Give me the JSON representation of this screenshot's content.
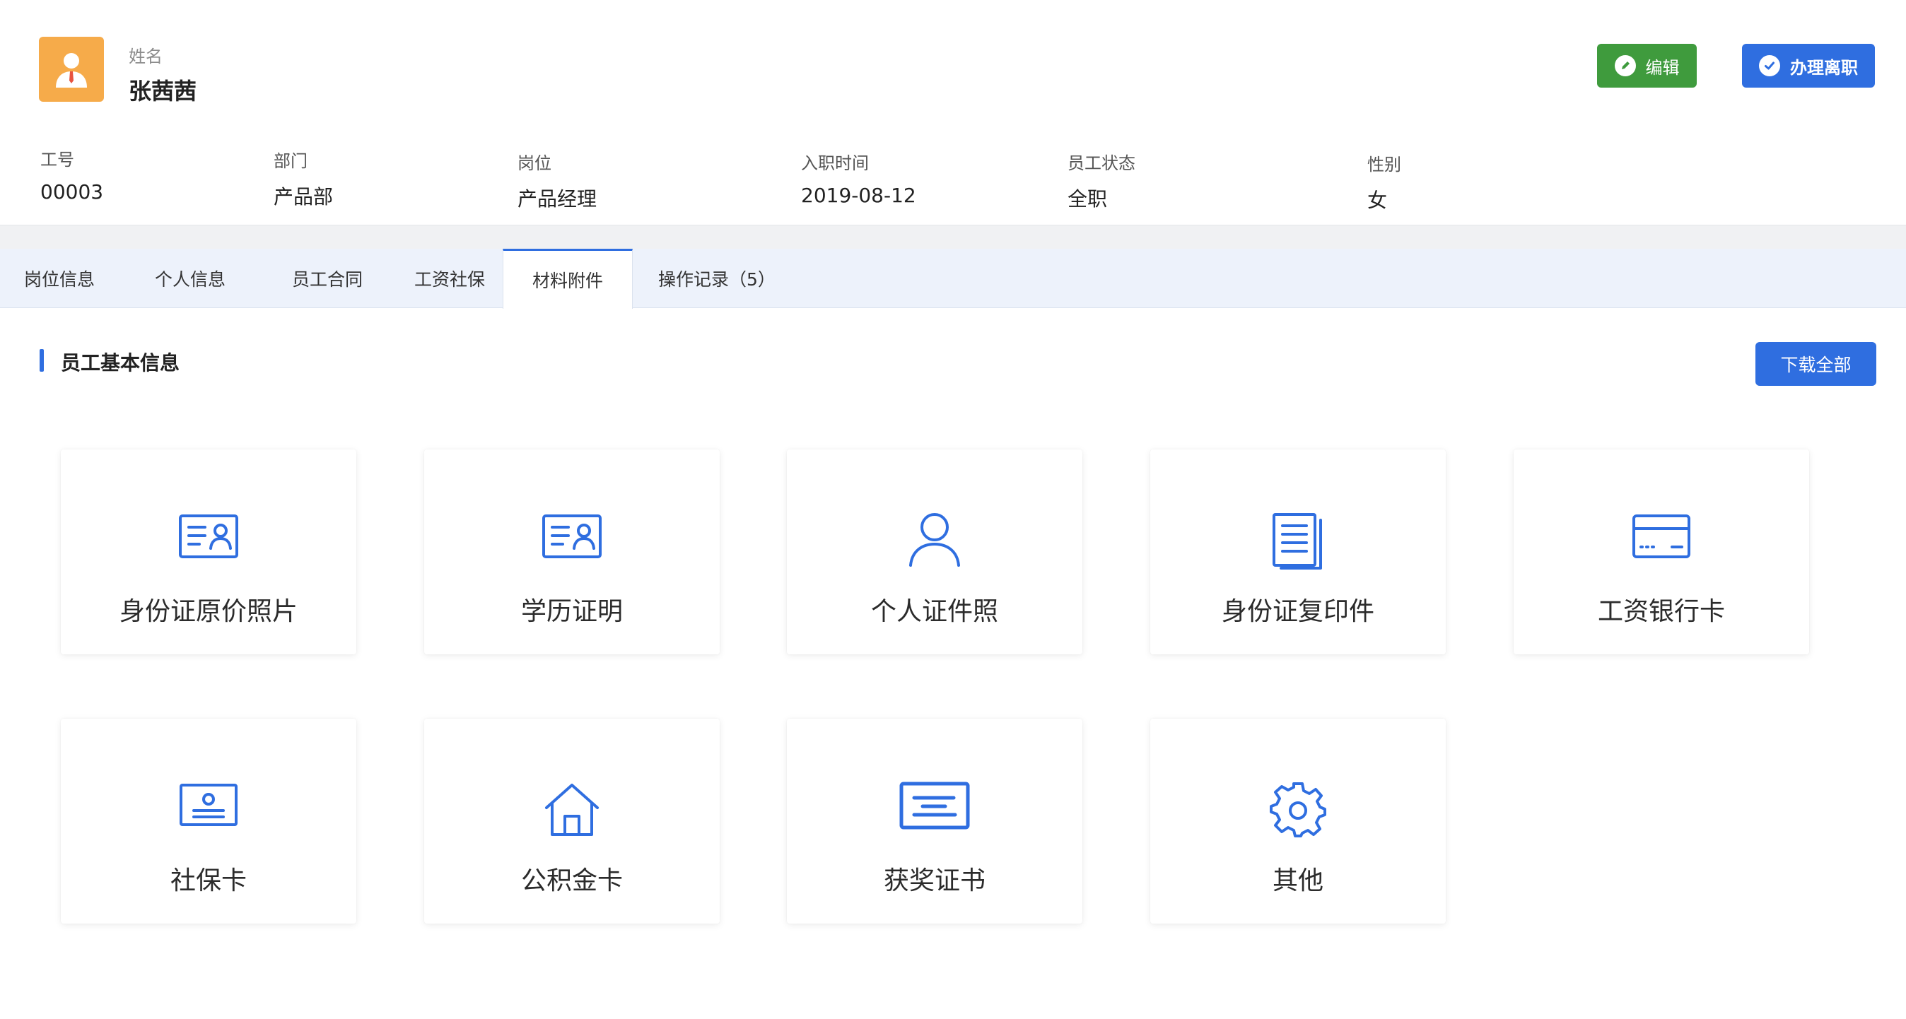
{
  "employee": {
    "name_label": "姓名",
    "name": "张茜茜",
    "fields": [
      {
        "label": "工号",
        "value": "00003"
      },
      {
        "label": "部门",
        "value": "产品部"
      },
      {
        "label": "岗位",
        "value": "产品经理"
      },
      {
        "label": "入职时间",
        "value": "2019-08-12"
      },
      {
        "label": "员工状态",
        "value": "全职"
      },
      {
        "label": "性别",
        "value": "女"
      }
    ]
  },
  "actions": {
    "edit_label": "编辑",
    "resign_label": "办理离职"
  },
  "tabs": [
    {
      "label": "岗位信息",
      "active": false
    },
    {
      "label": "个人信息",
      "active": false
    },
    {
      "label": "员工合同",
      "active": false
    },
    {
      "label": "工资社保",
      "active": false
    },
    {
      "label": "材料附件",
      "active": true
    },
    {
      "label": "操作记录（5）",
      "active": false
    }
  ],
  "section": {
    "title": "员工基本信息",
    "download_label": "下载全部"
  },
  "attachments": [
    {
      "label": "身份证原价照片",
      "icon": "id-card-icon"
    },
    {
      "label": "学历证明",
      "icon": "id-card-icon"
    },
    {
      "label": "个人证件照",
      "icon": "person-icon"
    },
    {
      "label": "身份证复印件",
      "icon": "document-icon"
    },
    {
      "label": "工资银行卡",
      "icon": "bank-card-icon"
    },
    {
      "label": "社保卡",
      "icon": "social-security-card-icon"
    },
    {
      "label": "公积金卡",
      "icon": "home-icon"
    },
    {
      "label": "获奖证书",
      "icon": "certificate-icon"
    },
    {
      "label": "其他",
      "icon": "gear-icon"
    }
  ],
  "colors": {
    "primary": "#2f6ee0",
    "edit_green": "#3f9b3d",
    "avatar_orange": "#f6ab4a",
    "icon_blue": "#2f6ee0"
  }
}
